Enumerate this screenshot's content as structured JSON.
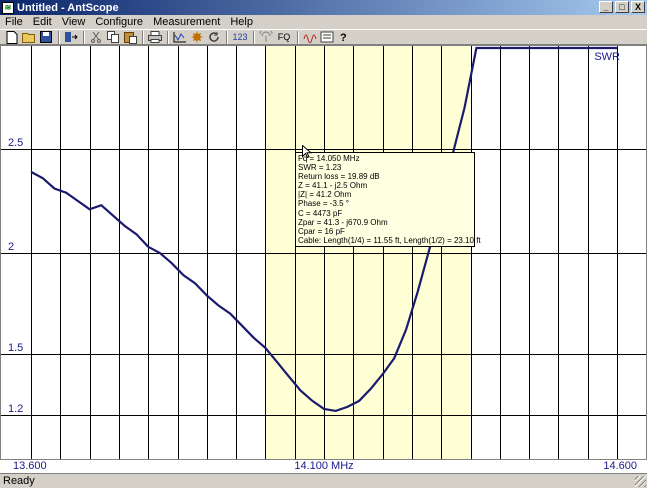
{
  "window": {
    "title": "Untitled - AntScope",
    "minimize_glyph": "_",
    "maximize_glyph": "□",
    "close_glyph": "X"
  },
  "menu": {
    "items": [
      "File",
      "Edit",
      "View",
      "Configure",
      "Measurement",
      "Help"
    ]
  },
  "toolbar": {
    "icons": [
      "new-file-icon",
      "open-folder-icon",
      "save-icon",
      "sep",
      "device-connect-icon",
      "sep",
      "cut-icon",
      "copy-icon",
      "paste-icon",
      "sep",
      "print-icon",
      "sep",
      "scan-icon",
      "settings-icon",
      "refresh-icon",
      "sep",
      "numeric-icon",
      "sep",
      "antenna-icon",
      "fq-button",
      "sep",
      "wave-icon",
      "chart-options-icon",
      "help-icon"
    ],
    "numeric_label": "123",
    "fq_label": "FQ"
  },
  "status": {
    "text": "Ready"
  },
  "tooltip": {
    "lines": [
      "Fq = 14.050 MHz",
      "SWR = 1.23",
      "Return loss = 19.89 dB",
      "Z = 41.1 - j2.5 Ohm",
      "|Z| = 41.2 Ohm",
      "Phase = -3.5 °",
      "C = 4473 pF",
      "Zpar = 41.3 - j670.9 Ohm",
      "Cpar = 16 pF",
      "Cable: Length(1/4) = 11.55 ft, Length(1/2) = 23.10 ft"
    ]
  },
  "colors": {
    "band_highlight": "#ffffd5",
    "curve": "#1a1a6e",
    "grid": "#000000",
    "label": "#1a1a8c"
  },
  "chart_data": {
    "type": "line",
    "series": [
      {
        "name": "SWR",
        "x": [
          13.6,
          13.62,
          13.64,
          13.66,
          13.68,
          13.7,
          13.72,
          13.74,
          13.76,
          13.78,
          13.8,
          13.82,
          13.84,
          13.86,
          13.88,
          13.9,
          13.92,
          13.94,
          13.96,
          13.98,
          14.0,
          14.02,
          14.04,
          14.06,
          14.08,
          14.1,
          14.12,
          14.14,
          14.16,
          14.18,
          14.2,
          14.22,
          14.24,
          14.26,
          14.28,
          14.3,
          14.32,
          14.34,
          14.36,
          14.38,
          14.4,
          14.42,
          14.44,
          14.46,
          14.48,
          14.5,
          14.52,
          14.54,
          14.56,
          14.58,
          14.6
        ],
        "y": [
          2.39,
          2.36,
          2.31,
          2.29,
          2.25,
          2.21,
          2.23,
          2.18,
          2.13,
          2.09,
          2.03,
          2.0,
          1.95,
          1.89,
          1.85,
          1.79,
          1.74,
          1.7,
          1.64,
          1.58,
          1.53,
          1.46,
          1.39,
          1.32,
          1.27,
          1.23,
          1.22,
          1.24,
          1.27,
          1.33,
          1.4,
          1.48,
          1.62,
          1.81,
          2.02,
          2.23,
          2.48,
          2.7,
          3.2,
          3.2,
          3.2,
          3.2,
          3.2,
          3.2,
          3.2,
          3.2,
          3.2,
          3.2,
          3.2,
          3.2,
          3.2
        ]
      }
    ],
    "xlim": [
      13.6,
      14.6
    ],
    "x_ticks": [
      "13.600",
      "14.100 MHz",
      "14.600"
    ],
    "y_ticks": [
      "1.2",
      "1.5",
      "2",
      "2.5"
    ],
    "highlight_band": [
      14.0,
      14.35
    ],
    "legend": "SWR",
    "grid": true
  }
}
